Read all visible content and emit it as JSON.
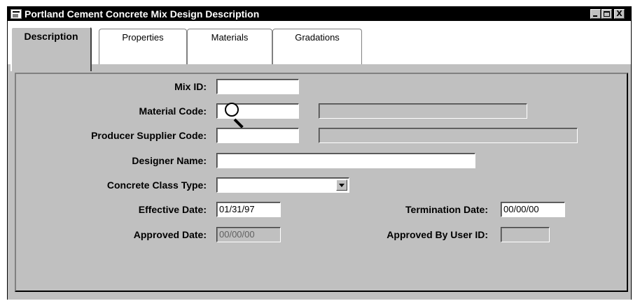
{
  "window": {
    "title": "Portland Cement Concrete Mix Design Description",
    "controls": {
      "close": "X"
    }
  },
  "tabs": [
    {
      "label": "Description",
      "active": true
    },
    {
      "label": "Properties",
      "active": false
    },
    {
      "label": "Materials",
      "active": false
    },
    {
      "label": "Gradations",
      "active": false
    }
  ],
  "form": {
    "mix_id": {
      "label": "Mix ID:",
      "value": ""
    },
    "material_code": {
      "label": "Material Code:",
      "value": "",
      "description": ""
    },
    "producer_supplier_code": {
      "label": "Producer Supplier Code:",
      "value": "",
      "description": ""
    },
    "designer_name": {
      "label": "Designer Name:",
      "value": ""
    },
    "concrete_class_type": {
      "label": "Concrete Class Type:",
      "value": ""
    },
    "effective_date": {
      "label": "Effective Date:",
      "value": "01/31/97"
    },
    "termination_date": {
      "label": "Termination Date:",
      "value": "00/00/00"
    },
    "approved_date": {
      "label": "Approved Date:",
      "value": "00/00/00"
    },
    "approved_by_user_id": {
      "label": "Approved By User ID:",
      "value": ""
    }
  },
  "colors": {
    "face": "#c0c0c0",
    "titlebar": "#000000",
    "field": "#ffffff"
  },
  "icons": [
    "app-icon",
    "magnifier-icon",
    "dropdown-arrow-icon"
  ]
}
